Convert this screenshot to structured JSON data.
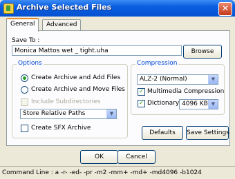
{
  "window": {
    "title": "Archive Selected Files",
    "close_label": "✕"
  },
  "tabs": [
    {
      "label": "General"
    },
    {
      "label": "Advanced"
    }
  ],
  "save_to": {
    "label": "Save To :",
    "value": "Monica Mattos wet _ tight.uha",
    "browse_label": "Browse"
  },
  "options": {
    "title": "Options",
    "create_add": "Create Archive and Add Files",
    "create_move": "Create Archive and Move Files",
    "include_subdirs": "Include Subdirectories",
    "path_mode": "Store Relative Paths",
    "sfx": "Create SFX Archive"
  },
  "compression": {
    "title": "Compression",
    "method": "ALZ-2 (Normal)",
    "multimedia": "Multimedia Compression",
    "dictionary_label": "Dictionary",
    "dictionary_size": "4096 KB",
    "defaults_label": "Defaults",
    "save_settings_label": "Save Settings"
  },
  "buttons": {
    "ok": "OK",
    "cancel": "Cancel"
  },
  "status": {
    "command_line": "Command Line : a -r- -ed- -pr -m2 -mm+ -md+ -md4096 -b1024"
  }
}
